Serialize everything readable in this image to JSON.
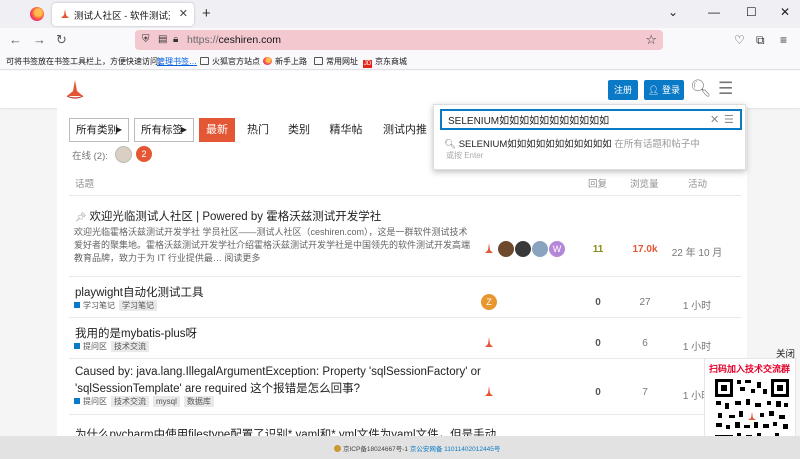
{
  "browser": {
    "tab_title": "测试人社区 - 软件测试开发爱好者的交流社区",
    "url_protocol": "https://",
    "url_host": "ceshiren.com"
  },
  "bookmarks": {
    "tip": "可将书签放在书签工具栏上，方便快速访问。",
    "manage": "管理书签…",
    "items": [
      "火狐官方站点",
      "新手上路",
      "常用网址",
      "京东商城"
    ]
  },
  "header": {
    "register": "注册",
    "login": "登录"
  },
  "filters": {
    "category": "所有类别",
    "tags": "所有标签"
  },
  "nav": [
    "最新",
    "热门",
    "类别",
    "精华帖",
    "测试内推"
  ],
  "online": {
    "label": "在线 (2):",
    "count": "2"
  },
  "columns": {
    "topic": "话题",
    "replies": "回复",
    "views": "浏览量",
    "activity": "活动"
  },
  "topics": [
    {
      "title": "欢迎光临测试人社区 | Powered by 霍格沃兹测试开发学社",
      "excerpt": "欢迎光临霍格沃兹测试开发学社 学员社区——测试人社区（ceshiren.com），这是一群软件测试技术爱好者的聚集地。霍格沃兹测试开发学社介绍霍格沃兹测试开发学社是中国领先的软件测试开发高端教育品牌，致力于为 IT 行业提供最… 阅读更多",
      "replies": "11",
      "views": "17.0k",
      "activity": "22 年 10 月"
    },
    {
      "title": "playwight自动化测试工具",
      "category": "学习笔记",
      "tags": [
        "学习笔记"
      ],
      "avatar_letter": "Z",
      "replies": "0",
      "views": "27",
      "activity": "1 小时"
    },
    {
      "title": "我用的是mybatis-plus呀",
      "category": "提问区",
      "tags": [
        "技术交流"
      ],
      "replies": "0",
      "views": "6",
      "activity": "1 小时"
    },
    {
      "title_line1": "Caused by: java.lang.IllegalArgumentException: Property 'sqlSessionFactory' or",
      "title_line2": "'sqlSessionTemplate' are required 这个报错是怎么回事?",
      "category": "提问区",
      "tags": [
        "技术交流",
        "mysql",
        "数据库"
      ],
      "replies": "0",
      "views": "7",
      "activity": "1 小时"
    },
    {
      "title": "为什么pycharm中使用filestype配置了识别*.yaml和*.yml文件为yaml文件，但是手动"
    }
  ],
  "search": {
    "query": "SELENIUM如如如如如如如如如如如",
    "suggestion": "SELENIUM如如如如如如如如如如如",
    "suggestion_hint": "在所有话题和帖子中",
    "enter_hint": "或按 Enter"
  },
  "qr": {
    "close": "关闭",
    "label": "扫码加入技术交流群"
  },
  "footer": {
    "icp": "京ICP备18024667号-1",
    "police_label": "京公安网备",
    "police_no": "11011402012445号"
  },
  "colors": {
    "accent": "#e45735",
    "primary": "#0a7ac6",
    "url_bg": "#f3c8ce"
  }
}
